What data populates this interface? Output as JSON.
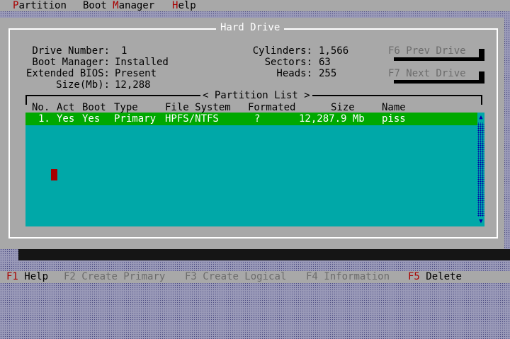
{
  "menu": {
    "partition": {
      "hotkey": "P",
      "rest": "artition"
    },
    "boot_manager": {
      "pre": "Boot ",
      "hotkey": "M",
      "rest": "anager"
    },
    "help": {
      "hotkey": "H",
      "rest": "elp"
    }
  },
  "dialog": {
    "title": "Hard Drive",
    "drive_number_label": "Drive Number:",
    "drive_number": "1",
    "boot_manager_label": "Boot Manager:",
    "boot_manager": "Installed",
    "extended_bios_label": "Extended BIOS:",
    "extended_bios": "Present",
    "size_label": "Size(Mb):",
    "size": "12,288",
    "cylinders_label": "Cylinders:",
    "cylinders": "1,566",
    "sectors_label": "Sectors:",
    "sectors": "63",
    "heads_label": "Heads:",
    "heads": "255",
    "prev_drive_button": "F6 Prev Drive",
    "next_drive_button": "F7 Next Drive"
  },
  "partition_list": {
    "title": "< Partition List >",
    "columns": {
      "no": "No.",
      "act": "Act",
      "boot": "Boot",
      "type": "Type",
      "file_system": "File System",
      "formated": "Formated",
      "size": "Size",
      "name": "Name"
    },
    "rows": [
      {
        "no": "1.",
        "act": "Yes",
        "boot": "Yes",
        "type": "Primary",
        "file_system": "HPFS/NTFS",
        "formated": "?",
        "size": "12,287.9 Mb",
        "name": "piss"
      }
    ]
  },
  "function_bar": {
    "f1": {
      "key": "F1",
      "label": "Help",
      "enabled": true
    },
    "f2": {
      "key": "F2",
      "label": "Create Primary",
      "enabled": false
    },
    "f3": {
      "key": "F3",
      "label": "Create Logical",
      "enabled": false
    },
    "f4": {
      "key": "F4",
      "label": "Information",
      "enabled": false
    },
    "f5": {
      "key": "F5",
      "label": "Delete",
      "enabled": true
    }
  },
  "colors": {
    "menu_bg": "#a8a8a8",
    "hotkey": "#a80000",
    "selection": "#00a800",
    "list_bg": "#00a8a8",
    "disabled_text": "#6c6c6c"
  }
}
